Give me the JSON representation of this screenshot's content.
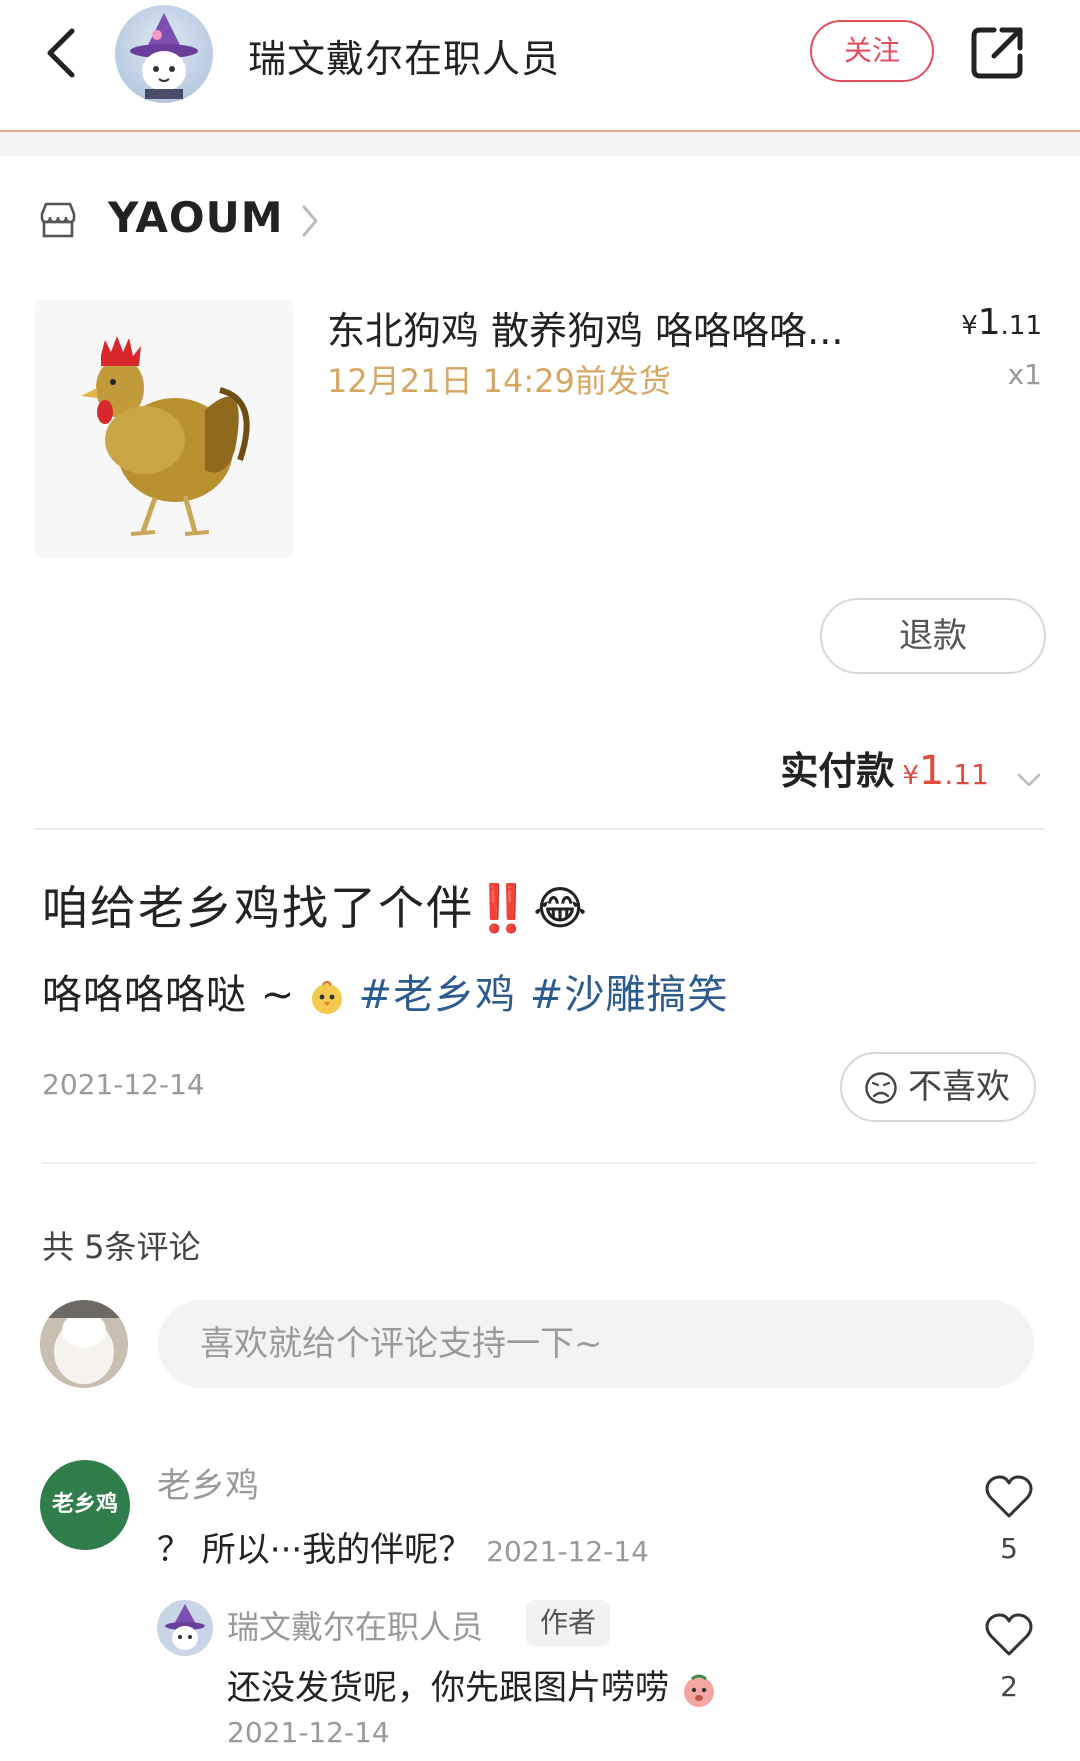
{
  "header": {
    "author_name": "瑞文戴尔在职人员",
    "follow_label": "关注",
    "icons": {
      "back": "back-arrow-icon",
      "share": "share-external-icon"
    }
  },
  "order": {
    "shop_name": "YAOUM",
    "shop_icon": "store-icon",
    "product": {
      "title": "东北狗鸡 散养狗鸡 咯咯咯咯...",
      "ship_time": "12月21日 14:29前发货",
      "price_currency": "¥",
      "price_int": "1",
      "price_dec": ".11",
      "quantity": "x1",
      "image": "rooster-image"
    },
    "refund_label": "退款",
    "paid_label": "实付款",
    "paid_currency": "¥",
    "paid_int": "1",
    "paid_dec": ".11"
  },
  "post": {
    "title": "咱给老乡鸡找了个伴‼️😂",
    "body_text": "咯咯咯咯哒 ~",
    "hashtags": [
      "#老乡鸡",
      "#沙雕搞笑"
    ],
    "date": "2021-12-14",
    "dislike_label": "不喜欢"
  },
  "comments_section": {
    "count_label": "共 5条评论",
    "input_placeholder": "喜欢就给个评论支持一下~",
    "comments": [
      {
        "name": "老乡鸡",
        "avatar_text": "老乡鸡",
        "text": "？ 所以···我的伴呢？",
        "date": "2021-12-14",
        "likes": "5"
      },
      {
        "name": "瑞文戴尔在职人员",
        "badge": "作者",
        "text": "还没发货呢，你先跟图片唠唠",
        "date": "2021-12-14",
        "likes": "2"
      }
    ]
  },
  "colors": {
    "accent_red": "#e04f5f",
    "price_red": "#e24a3b",
    "ship_gold": "#d6a763",
    "hashtag_blue": "#2c5b8f",
    "brand_green": "#2f7d4a"
  }
}
